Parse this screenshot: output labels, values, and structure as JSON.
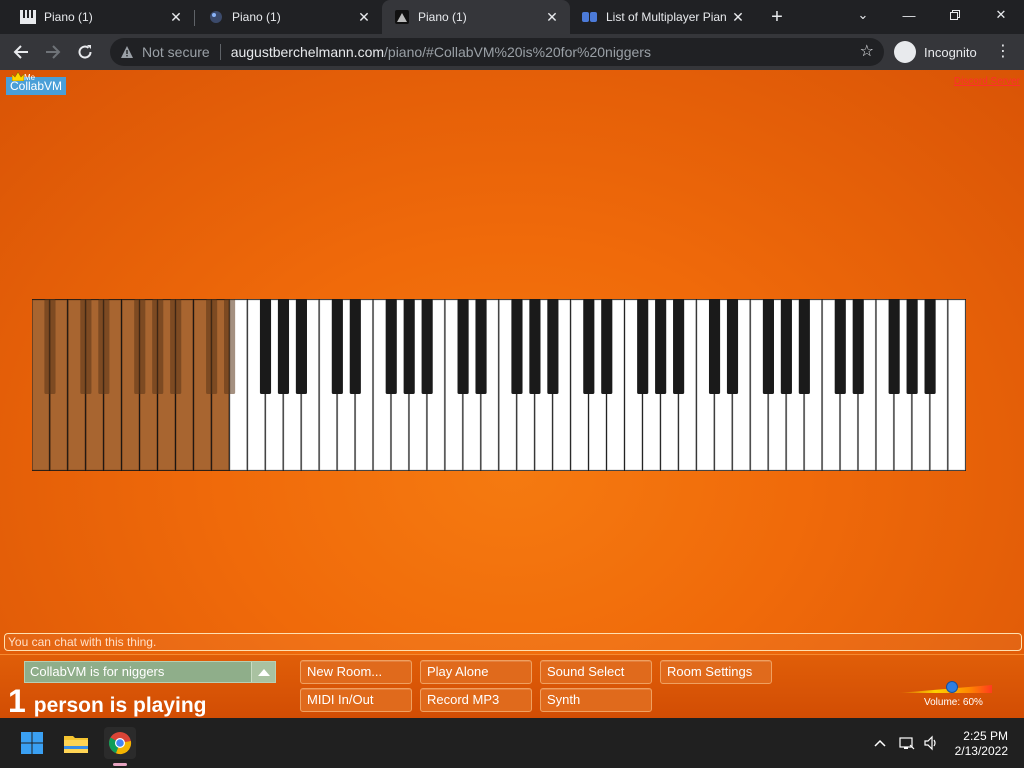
{
  "browser": {
    "tabs": [
      {
        "title": "Piano (1)",
        "active": false
      },
      {
        "title": "Piano (1)",
        "active": false
      },
      {
        "title": "Piano (1)",
        "active": true
      },
      {
        "title": "List of Multiplayer Pian",
        "active": false
      }
    ],
    "security_label": "Not secure",
    "url_host": "augustberchelmann.com",
    "url_path": "/piano/#CollabVM%20is%20for%20niggers",
    "profile_label": "Incognito"
  },
  "page": {
    "room_badge": "CollabVM",
    "me_label": "Me",
    "discord_link": "Discord Server",
    "chat_placeholder": "You can chat with this thing.",
    "room_name": "CollabVM is for niggers",
    "player_count": "1",
    "player_text": "person is playing",
    "buttons": {
      "new_room": "New Room...",
      "play_alone": "Play Alone",
      "sound_select": "Sound Select",
      "room_settings": "Room Settings",
      "midi": "MIDI In/Out",
      "record": "Record MP3",
      "synth": "Synth"
    },
    "volume_label": "Volume: 60%",
    "volume_level": 0.6,
    "keyboard": {
      "white_keys": 52,
      "dimmed_white_keys": 11
    }
  },
  "taskbar": {
    "time": "2:25 PM",
    "date": "2/13/2022"
  },
  "colors": {
    "accent": "#f06a0a",
    "button_bg": "#e06a1c",
    "room_badge": "#4a9fd8"
  }
}
